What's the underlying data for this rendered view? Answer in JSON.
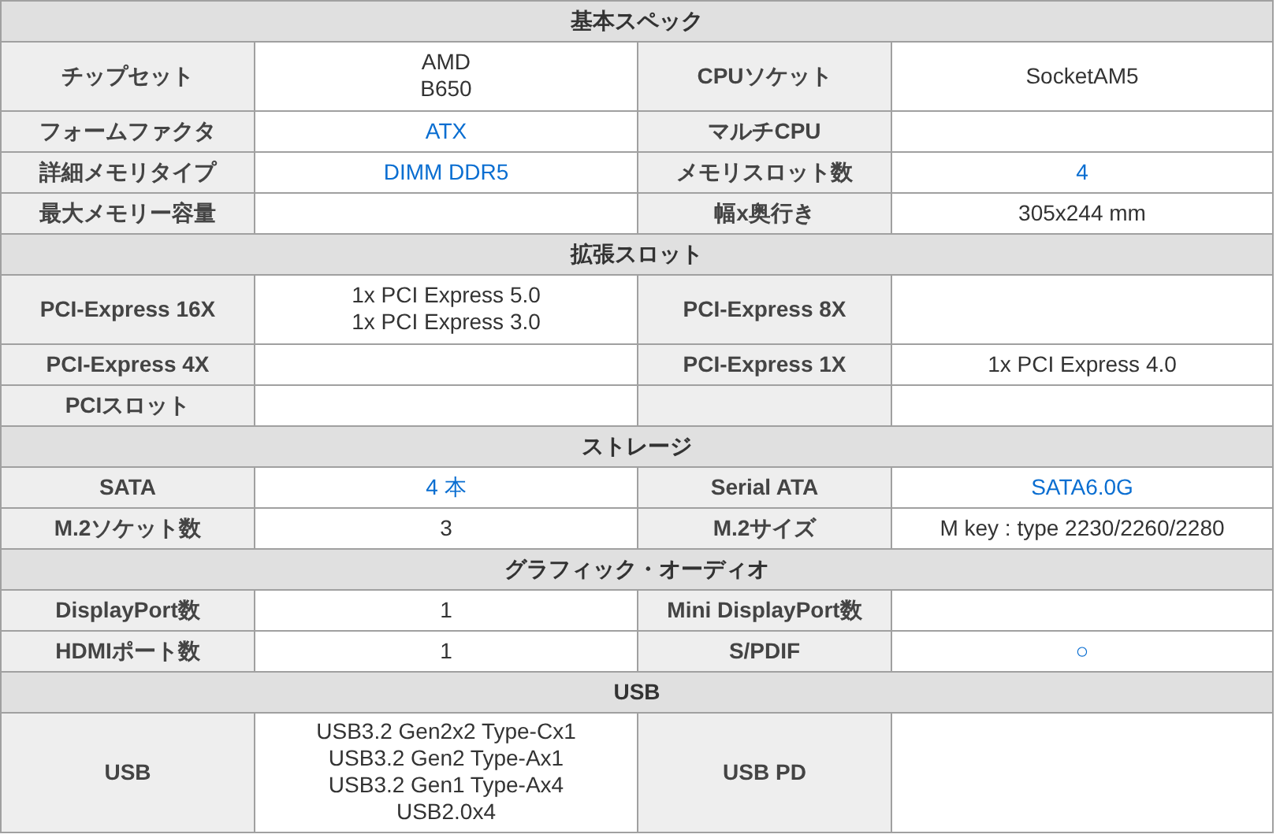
{
  "sections": [
    {
      "title": "基本スペック",
      "rows": [
        {
          "cells": [
            {
              "label": "チップセット",
              "value": {
                "kind": "text",
                "lines": [
                  "AMD",
                  "B650"
                ]
              }
            },
            {
              "label": "CPUソケット",
              "value": {
                "kind": "text",
                "lines": [
                  "SocketAM5"
                ]
              }
            }
          ]
        },
        {
          "cells": [
            {
              "label": "フォームファクタ",
              "value": {
                "kind": "link",
                "lines": [
                  "ATX"
                ]
              }
            },
            {
              "label": "マルチCPU"
            }
          ]
        },
        {
          "cells": [
            {
              "label": "詳細メモリタイプ",
              "value": {
                "kind": "link",
                "lines": [
                  "DIMM DDR5"
                ]
              }
            },
            {
              "label": "メモリスロット数",
              "value": {
                "kind": "link",
                "lines": [
                  "4"
                ]
              }
            }
          ]
        },
        {
          "cells": [
            {
              "label": "最大メモリー容量"
            },
            {
              "label": "幅x奥行き",
              "value": {
                "kind": "text",
                "lines": [
                  "305x244 mm"
                ]
              }
            }
          ]
        }
      ]
    },
    {
      "title": "拡張スロット",
      "rows": [
        {
          "cells": [
            {
              "label": "PCI-Express 16X",
              "value": {
                "kind": "text",
                "lines": [
                  "1x PCI Express 5.0",
                  "1x PCI Express 3.0"
                ]
              }
            },
            {
              "label": "PCI-Express 8X"
            }
          ]
        },
        {
          "cells": [
            {
              "label": "PCI-Express 4X"
            },
            {
              "label": "PCI-Express 1X",
              "value": {
                "kind": "text",
                "lines": [
                  "1x PCI Express 4.0"
                ]
              }
            }
          ]
        },
        {
          "cells": [
            {
              "label": "PCIスロット"
            }
          ]
        }
      ]
    },
    {
      "title": "ストレージ",
      "rows": [
        {
          "cells": [
            {
              "label": "SATA",
              "value": {
                "kind": "link",
                "lines": [
                  "4 本"
                ]
              }
            },
            {
              "label": "Serial ATA",
              "value": {
                "kind": "link",
                "lines": [
                  "SATA6.0G"
                ]
              }
            }
          ]
        },
        {
          "cells": [
            {
              "label": "M.2ソケット数",
              "value": {
                "kind": "text",
                "lines": [
                  "3"
                ]
              }
            },
            {
              "label": "M.2サイズ",
              "value": {
                "kind": "text",
                "lines": [
                  "M key : type 2230/2260/2280"
                ]
              }
            }
          ]
        }
      ]
    },
    {
      "title": "グラフィック・オーディオ",
      "rows": [
        {
          "cells": [
            {
              "label": "DisplayPort数",
              "value": {
                "kind": "text",
                "lines": [
                  "1"
                ]
              }
            },
            {
              "label": "Mini DisplayPort数"
            }
          ]
        },
        {
          "cells": [
            {
              "label": "HDMIポート数",
              "value": {
                "kind": "text",
                "lines": [
                  "1"
                ]
              }
            },
            {
              "label": "S/PDIF",
              "value": {
                "kind": "link",
                "lines": [
                  "○"
                ]
              }
            }
          ]
        }
      ]
    },
    {
      "title": "USB",
      "rows": [
        {
          "cells": [
            {
              "label": "USB",
              "value": {
                "kind": "text",
                "lines": [
                  "USB3.2 Gen2x2 Type-Cx1",
                  "USB3.2 Gen2 Type-Ax1",
                  "USB3.2 Gen1 Type-Ax4",
                  "USB2.0x4"
                ]
              }
            },
            {
              "label": "USB PD"
            }
          ]
        }
      ]
    }
  ]
}
